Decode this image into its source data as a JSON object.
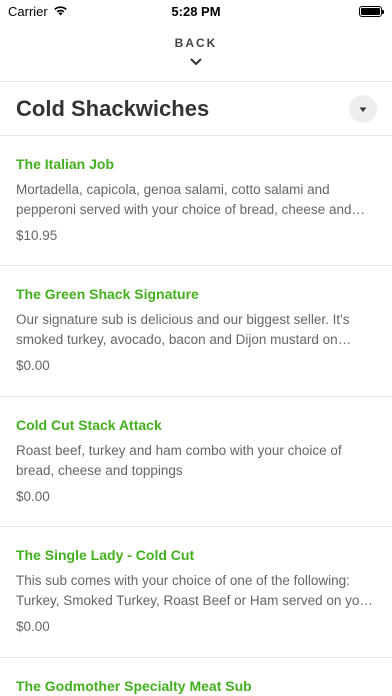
{
  "status": {
    "carrier": "Carrier",
    "time": "5:28 PM",
    "battery_level": 1.0
  },
  "nav": {
    "back_label": "BACK"
  },
  "category": {
    "title": "Cold Shackwiches"
  },
  "items": [
    {
      "name": "The Italian Job",
      "description": "Mortadella, capicola, genoa salami, cotto salami and pepperoni served with your choice of bread, cheese and toppings",
      "price": "$10.95"
    },
    {
      "name": "The Green Shack Signature",
      "description": "Our signature sub is delicious and our biggest seller.  It's smoked turkey, avocado, bacon and Dijon mustard on toasted bread",
      "price": "$0.00"
    },
    {
      "name": "Cold Cut Stack Attack",
      "description": "Roast beef, turkey and ham combo with your choice of bread, cheese and toppings",
      "price": "$0.00"
    },
    {
      "name": "The Single Lady - Cold Cut",
      "description": "This sub comes with your choice of one of the following: Turkey, Smoked Turkey, Roast Beef or Ham served on your choice of bread",
      "price": "$0.00"
    },
    {
      "name": "The Godmother Specialty Meat Sub",
      "description": "",
      "price": ""
    }
  ],
  "colors": {
    "accent_green": "#43b01e",
    "text_gray": "#666666"
  }
}
